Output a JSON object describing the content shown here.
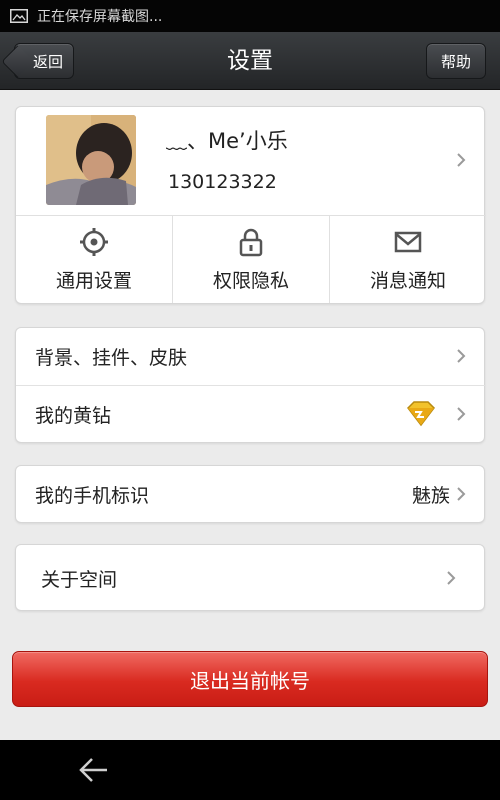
{
  "status_bar": {
    "text": "正在保存屏幕截图...",
    "icon": "screenshot-icon"
  },
  "header": {
    "back_label": "返回",
    "title": "设置",
    "help_label": "帮助"
  },
  "profile": {
    "nickname": "﹏、Me’小乐",
    "qq_number": "130123322"
  },
  "shortcuts": [
    {
      "label": "通用设置",
      "icon": "gear-icon"
    },
    {
      "label": "权限隐私",
      "icon": "lock-icon"
    },
    {
      "label": "消息通知",
      "icon": "envelope-icon"
    }
  ],
  "group1": [
    {
      "label": "背景、挂件、皮肤"
    },
    {
      "label": "我的黄钻",
      "icon": "yellow-diamond-icon"
    }
  ],
  "group2": [
    {
      "label": "我的手机标识",
      "value": "魅族"
    }
  ],
  "group3": [
    {
      "label": "关于空间"
    }
  ],
  "logout_label": "退出当前帐号",
  "colors": {
    "accent_red": "#d92a20",
    "header_dark": "#2c2e31",
    "background": "#ebebeb"
  }
}
